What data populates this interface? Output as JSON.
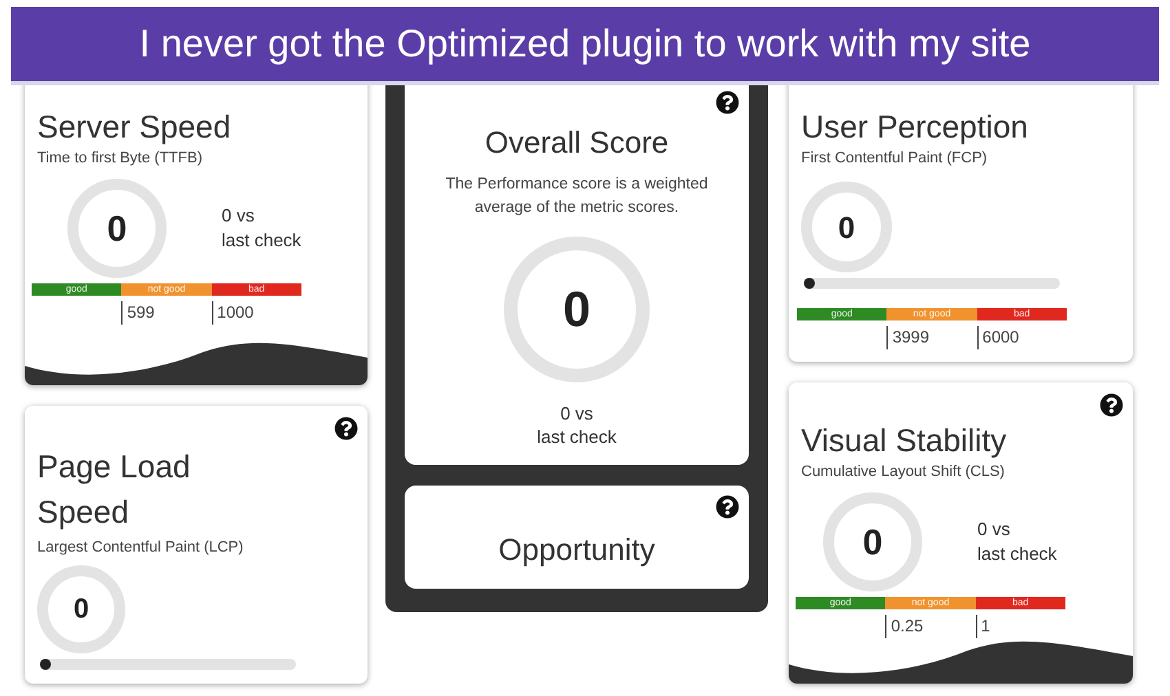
{
  "banner": {
    "text": "I never got the Optimized plugin to work with my site"
  },
  "left": [
    {
      "kind": "comparison",
      "title_lines": [
        "Server Speed"
      ],
      "subtitle": "Time to first Byte (TTFB)",
      "score": "0",
      "comparison_lines": [
        "0 vs",
        "last check"
      ],
      "thresholds": [
        {
          "label": "good",
          "color": "#2e8b24"
        },
        {
          "label": "not good",
          "color": "#f0922e"
        },
        {
          "label": "bad",
          "color": "#e0281e"
        }
      ],
      "threshold_values": [
        "599",
        "1000"
      ],
      "wave": true
    },
    {
      "kind": "progress",
      "help": true,
      "title_lines": [
        "Page Load",
        "Speed"
      ],
      "subtitle": "Largest Contentful Paint (LCP)",
      "score": "0",
      "progress": {
        "level": 0
      }
    }
  ],
  "center": {
    "overall": {
      "help": true,
      "title": "Overall Score",
      "description": "The Performance score is a weighted average of the metric scores.",
      "score": "0",
      "comparison_lines": [
        "0 vs",
        "last check"
      ]
    },
    "opportunity": {
      "help": true,
      "title": "Opportunity"
    }
  },
  "right": [
    {
      "kind": "progress",
      "title_lines": [
        "User Perception"
      ],
      "subtitle": "First Contentful Paint (FCP)",
      "score": "0",
      "progress": {
        "level": 0
      },
      "thresholds": [
        {
          "label": "good",
          "color": "#2e8b24"
        },
        {
          "label": "not good",
          "color": "#f0922e"
        },
        {
          "label": "bad",
          "color": "#e0281e"
        }
      ],
      "threshold_values": [
        "3999",
        "6000"
      ]
    },
    {
      "kind": "comparison",
      "help": true,
      "title_lines": [
        "Visual Stability"
      ],
      "subtitle": "Cumulative Layout Shift (CLS)",
      "score": "0",
      "comparison_lines": [
        "0 vs",
        "last check"
      ],
      "thresholds": [
        {
          "label": "good",
          "color": "#2e8b24"
        },
        {
          "label": "not good",
          "color": "#f0922e"
        },
        {
          "label": "bad",
          "color": "#e0281e"
        }
      ],
      "threshold_values": [
        "0.25",
        "1"
      ],
      "wave": true
    }
  ]
}
